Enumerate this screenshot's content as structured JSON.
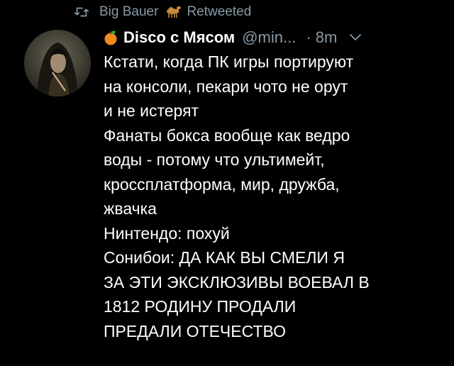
{
  "retweet": {
    "user": "Big Bauer",
    "emoji_icon": "camel-icon",
    "label": "Retweeted"
  },
  "tweet": {
    "author_emoji_icon": "tangerine-icon",
    "display_name": "Disco с Мясом",
    "handle": "@min...",
    "time": "· 8m",
    "lines": [
      "Кстати, когда ПК игры портируют",
      "на консоли, пекари чото не орут",
      "и не истерят",
      "Фанаты бокса вообще как ведро",
      "воды - потому что ультимейт,",
      "кроссплатформа, мир, дружба,",
      "жвачка",
      "Нинтендо: похуй",
      "Сонибои: ДА КАК ВЫ СМЕЛИ Я",
      "ЗА ЭТИ ЭКСКЛЮЗИВЫ ВОЕВАЛ В",
      "1812 РОДИНУ ПРОДАЛИ",
      "ПРЕДАЛИ ОТЕЧЕСТВО"
    ]
  },
  "colors": {
    "background": "#000000",
    "text": "#ffffff",
    "muted": "#8899a6"
  }
}
